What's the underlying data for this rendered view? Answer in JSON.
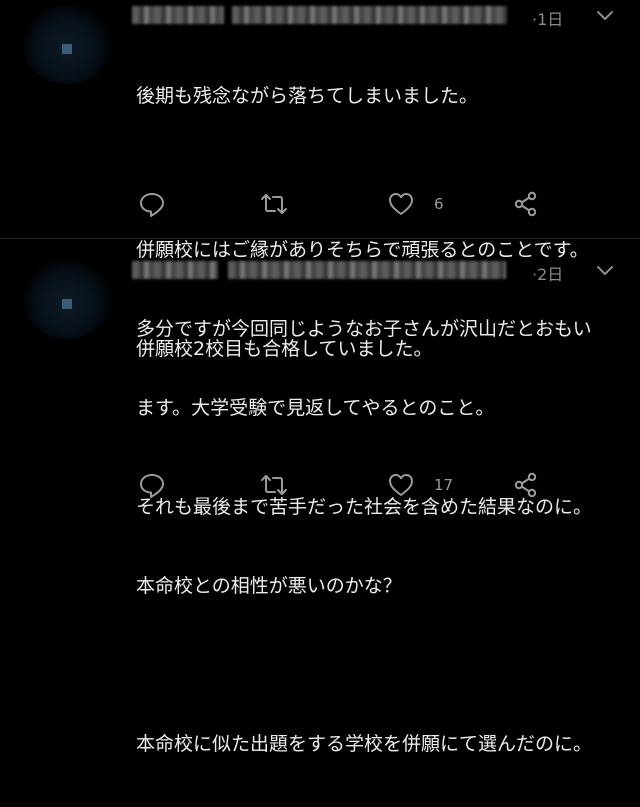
{
  "tweets": [
    {
      "time": "·1日",
      "lines": [
        "後期も残念ながら落ちてしまいました。",
        "",
        "併願校にはご縁がありそちらで頑張るとのことです。",
        "多分ですが今回同じようなお子さんが沢山だとおもい",
        "ます。大学受験で見返してやるとのこと。"
      ],
      "like_count": "6"
    },
    {
      "time": "·2日",
      "lines": [
        "併願校2校目も合格していました。",
        "",
        "それも最後まで苦手だった社会を含めた結果なのに。",
        "本命校との相性が悪いのかな？",
        "",
        "本命校に似た出題をする学校を併願にて選んだのに。"
      ],
      "like_count": "17"
    }
  ],
  "icons": {
    "reply": "reply-icon",
    "retweet": "retweet-icon",
    "like": "heart-icon",
    "share": "share-icon",
    "more": "chevron-down-icon"
  },
  "colors": {
    "background": "#000000",
    "text": "#ececec",
    "muted": "#8b8b8b"
  }
}
